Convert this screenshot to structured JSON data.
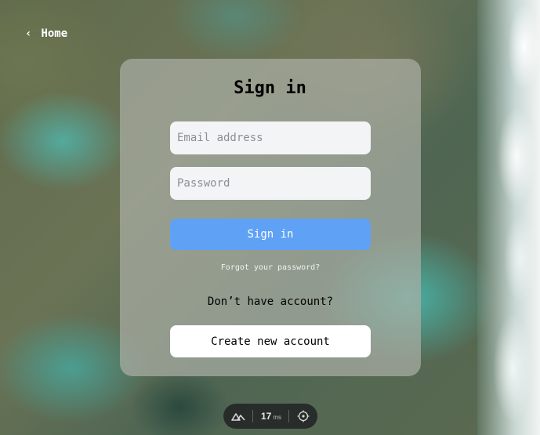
{
  "nav": {
    "back_label": "Home",
    "back_icon": "chevron-left-icon"
  },
  "signin": {
    "title": "Sign in",
    "email_placeholder": "Email address",
    "password_placeholder": "Password",
    "submit_label": "Sign in",
    "forgot_label": "Forgot your password?",
    "no_account_text": "Don’t have account?",
    "create_label": "Create new account"
  },
  "devtools": {
    "logo_icon": "nuxt-logo-icon",
    "timing_value": "17",
    "timing_unit": "ms",
    "inspect_icon": "crosshair-icon"
  },
  "colors": {
    "primary_button": "#5fa1f4",
    "input_background": "#f3f4f6",
    "card_background": "rgba(170,175,165,0.72)"
  }
}
